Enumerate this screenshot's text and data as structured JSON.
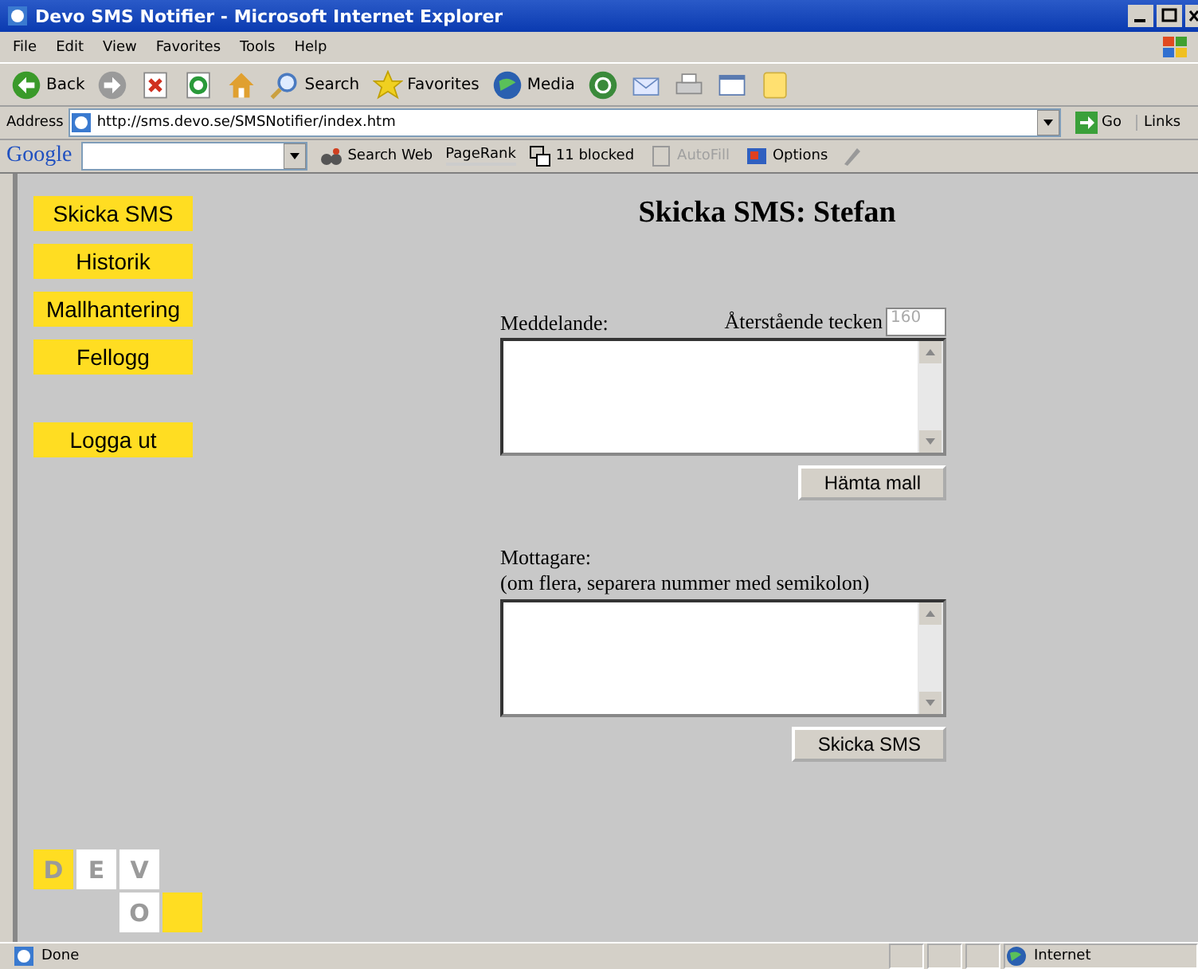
{
  "window": {
    "title": "Devo SMS Notifier - Microsoft Internet Explorer"
  },
  "menu": [
    "File",
    "Edit",
    "View",
    "Favorites",
    "Tools",
    "Help"
  ],
  "toolbar": [
    {
      "kind": "back",
      "label": "Back"
    },
    {
      "kind": "forward"
    },
    {
      "kind": "stop"
    },
    {
      "kind": "refresh"
    },
    {
      "kind": "home"
    },
    {
      "kind": "search",
      "label": "Search"
    },
    {
      "kind": "favorites",
      "label": "Favorites"
    },
    {
      "kind": "media",
      "label": "Media"
    },
    {
      "kind": "history"
    },
    {
      "kind": "mail"
    },
    {
      "kind": "print"
    },
    {
      "kind": "edit"
    },
    {
      "kind": "note"
    }
  ],
  "address_bar": {
    "label": "Address",
    "url": "http://sms.devo.se/SMSNotifier/index.htm",
    "go": "Go",
    "links": "Links"
  },
  "google_bar": {
    "logo": "Google",
    "search_web": "Search Web",
    "pagerank": "PageRank",
    "blocked": "11 blocked",
    "autofill": {
      "label": "AutoFill",
      "disabled": true
    },
    "options": "Options"
  },
  "nav": [
    {
      "label": "Skicka SMS"
    },
    {
      "label": "Historik"
    },
    {
      "label": "Mallhantering"
    },
    {
      "label": "Fellogg"
    }
  ],
  "logout": "Logga ut",
  "heading": "Skicka SMS: Stefan",
  "message": {
    "label": "Meddelande:",
    "remaining_label": "Återstående tecken",
    "remaining": "160",
    "button": "Hämta mall"
  },
  "recipients": {
    "label": "Mottagare:",
    "hint": "(om flera, separera nummer med semikolon)",
    "button": "Skicka SMS"
  },
  "logo": [
    {
      "letter": "D",
      "color": "#ffdd22"
    },
    {
      "letter": "E",
      "color": "#ffffff"
    },
    {
      "letter": "V",
      "color": "#ffffff"
    },
    {
      "letter": "O",
      "color": "#ffffff"
    }
  ],
  "status_bar": {
    "text": "Done",
    "zone": "Internet"
  }
}
